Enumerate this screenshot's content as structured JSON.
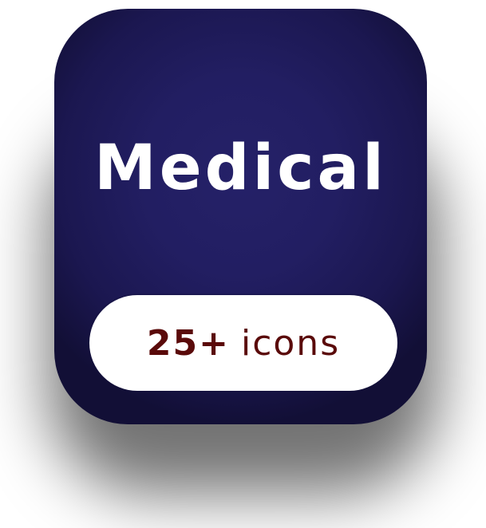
{
  "badge": {
    "title": "Medical",
    "count": "25+",
    "unit": "icons"
  },
  "colors": {
    "card_background": "#231f65",
    "card_edge": "#120f36",
    "title_text": "#ffffff",
    "pill_background": "#ffffff",
    "pill_text": "#5a0a0a"
  }
}
